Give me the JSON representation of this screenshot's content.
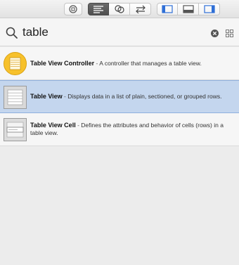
{
  "toolbar": {
    "buttons": [
      {
        "name": "library-toggle",
        "icon": "circle-dot-icon",
        "active": false
      },
      {
        "name": "standard-editor",
        "icon": "lines-icon",
        "active": true
      },
      {
        "name": "assistant-editor",
        "icon": "overlapping-circles-icon",
        "active": false
      },
      {
        "name": "version-editor",
        "icon": "swap-arrows-icon",
        "active": false
      },
      {
        "name": "navigator-toggle",
        "icon": "left-panel-icon",
        "active": true
      },
      {
        "name": "debug-area-toggle",
        "icon": "bottom-panel-icon",
        "active": false
      },
      {
        "name": "utilities-toggle",
        "icon": "right-panel-icon",
        "active": true
      }
    ]
  },
  "search": {
    "value": "table",
    "icon": "search-icon",
    "clear_icon": "clear-circle-icon",
    "grid_icon": "grid-view-icon"
  },
  "results": [
    {
      "title": "Table View Controller",
      "separator": " - ",
      "description": "A controller that manages a table view.",
      "icon": "table-view-controller-icon",
      "selected": false
    },
    {
      "title": "Table View",
      "separator": " - ",
      "description": "Displays data in a list of plain, sectioned, or grouped rows.",
      "icon": "table-view-icon",
      "selected": true
    },
    {
      "title": "Table View Cell",
      "separator": " - ",
      "description": "Defines the attributes and behavior of cells (rows) in a table view.",
      "icon": "table-view-cell-icon",
      "selected": false
    }
  ],
  "colors": {
    "selection": "#c4d6ee",
    "accent_blue": "#2f6fd6",
    "controller_yellow": "#f7c12b"
  }
}
